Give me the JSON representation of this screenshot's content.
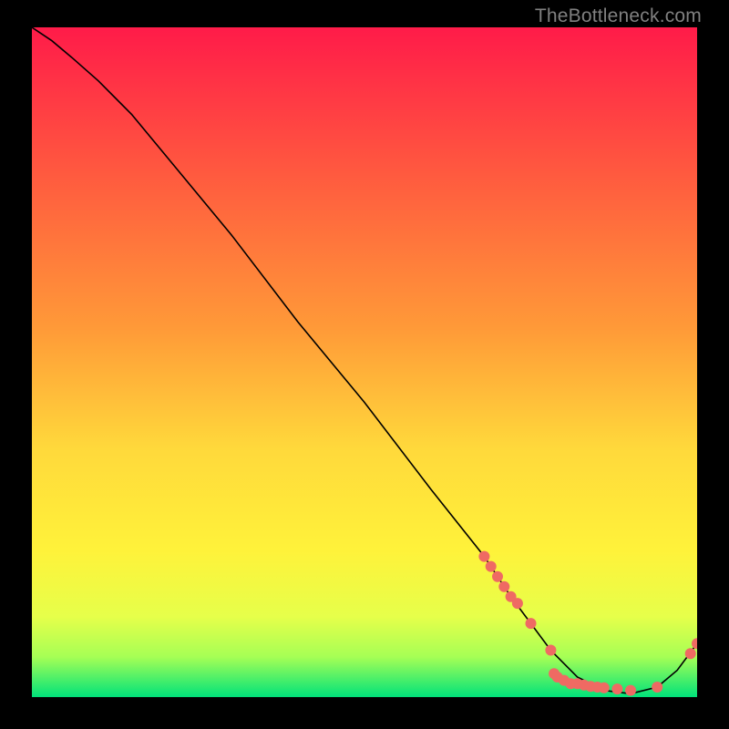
{
  "watermark": "TheBottleneck.com",
  "chart_data": {
    "type": "line",
    "title": "",
    "xlabel": "",
    "ylabel": "",
    "xlim": [
      0,
      100
    ],
    "ylim": [
      0,
      100
    ],
    "grid": false,
    "legend": false,
    "background_gradient": {
      "top": "#ff1b49",
      "mid_upper": "#ff7a3a",
      "mid": "#ffd93b",
      "mid_lower": "#fff23a",
      "lower": "#d8ff4a",
      "bottom": "#00e27a"
    },
    "series": [
      {
        "name": "bottleneck-curve",
        "type": "line",
        "color": "#000000",
        "stroke_width": 1.6,
        "x": [
          0,
          3,
          6,
          10,
          15,
          20,
          30,
          40,
          50,
          60,
          68,
          72,
          75,
          78,
          82,
          86,
          90,
          94,
          97,
          100
        ],
        "y": [
          100,
          98,
          95.5,
          92,
          87,
          81,
          69,
          56,
          44,
          31,
          21,
          15,
          11,
          7,
          3,
          1,
          0.5,
          1.5,
          4,
          8
        ]
      },
      {
        "name": "data-points",
        "type": "scatter",
        "color": "#ef6a63",
        "radius": 6,
        "x": [
          68,
          69,
          70,
          71,
          72,
          73,
          75,
          78,
          78.5,
          79,
          80,
          81,
          82,
          83,
          84,
          85,
          86,
          88,
          90,
          94,
          99,
          100
        ],
        "y": [
          21,
          19.5,
          18,
          16.5,
          15,
          14,
          11,
          7,
          3.5,
          3,
          2.5,
          2,
          2,
          1.8,
          1.6,
          1.5,
          1.4,
          1.2,
          1,
          1.5,
          6.5,
          8
        ]
      }
    ]
  }
}
